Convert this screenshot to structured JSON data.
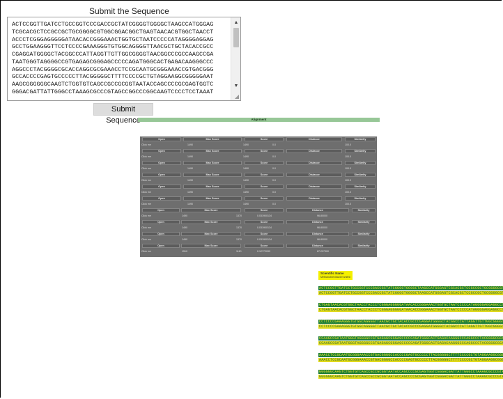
{
  "form": {
    "title": "Submit the Sequence",
    "sequence": "ACTCCGGTTGATCCTGCCGGTCCCGACCGCTATCGGGGTGGGGCTAAGCCATGGGAG\nTCGCACGCTCCGCCGCTGCGGGGCGTGGCGGACGGCTGAGTAACACGTGGCTAACCT\nACCCTCGGGAGGGGGATAACACCGGGAAACTGGTGCTAATCCCCCATAGGGGAGGAG\nGCCTGGAAGGGTTCCTCCCCGAAAGGGTGTGGCAGGGGTTAACGCTGCTACACCGCC\nCGAGGATGGGGCTACGGCCCATTAGGTTGTTGGCGGGGTAACGGCCCGCCAAGCCGA\nTAATGGGTAGGGGCCGTGAGAGCGGGAGCCCCCAGATGGGCACTGAGACAAGGGCCC\nAGGCCCTACGGGGCGCACCAGGCGCGAAACCTCCGCAATGCGGGAAACCGTGACGGG\nGCCACCCCGAGTGCCCCCTTACGGGGGCTTTTCCCCGCTGTAGGAAGGCGGGGGAAT\nAAGCGGGGGGCAAGTCTGGTGTCAGCCGCCGCGGTAATACCAGCCCCGCGAGTGGTC\nGGGACGATTATTGGGCCTAAAGCGCCCGTAGCCGGCCCGGCAAGTCCCCTCCTAAAT",
    "submit_label": "Submit Sequence"
  },
  "alignment": {
    "title": "Alignment",
    "headers": {
      "open": "Open",
      "max_score": "Max Score",
      "score": "Score",
      "distance": "Distance",
      "similarity": "Similarity"
    },
    "rows": [
      {
        "action": "Click me",
        "max_score": "1490",
        "score": "1490",
        "distance": "0.0",
        "similarity": "100.0"
      },
      {
        "action": "Click me",
        "max_score": "1490",
        "score": "1490",
        "distance": "0.0",
        "similarity": "100.0"
      },
      {
        "action": "Click me",
        "max_score": "1490",
        "score": "1490",
        "distance": "0.0",
        "similarity": "100.0"
      },
      {
        "action": "Click me",
        "max_score": "1490",
        "score": "1490",
        "distance": "0.0",
        "similarity": "100.0"
      },
      {
        "action": "Click me",
        "max_score": "1490",
        "score": "1490",
        "distance": "0.0",
        "similarity": "100.0"
      },
      {
        "action": "Click me",
        "max_score": "1490",
        "score": "1490",
        "distance": "0.0",
        "similarity": "100.0"
      },
      {
        "action": "Click me",
        "max_score": "1490",
        "score": "1370",
        "distance": "0.031900134",
        "similarity": "96.80000"
      },
      {
        "action": "Click me",
        "max_score": "1490",
        "score": "1370",
        "distance": "0.031900134",
        "similarity": "96.80000"
      },
      {
        "action": "Click me",
        "max_score": "1490",
        "score": "1370",
        "distance": "0.031900134",
        "similarity": "96.80000"
      },
      {
        "action": "Click me",
        "max_score": "1510",
        "score": "1110",
        "distance": "0.12772099",
        "similarity": "87.227900"
      }
    ]
  },
  "scientific": {
    "label": "Scientific Name",
    "value": "Methanobrevibacter smithii"
  },
  "sequence_strips": [
    {
      "top": "ACTCCGGTTGATCCTGCCGGTCCCGACCGCTATCGGGGTGGGGCTAAGCCATGGGAGTCGCACGCTCCGCCGCTGCGGGGCGTGGCGGACGG",
      "bottom": "ACTCCGGTTGATCCTGCCGGTCCCGACCGCTATCGGGGTGGGGCTAAGCCATGGGAGTCGCACGCTCCGCCGCTGCGGGGCGTGGCGGACGG"
    },
    {
      "top": "CTGAGTAACACGTGGCTAACCTACCCTCGGGAGGGGGATAACACCGGGAAACTGGTGCTAATCCCCCATAGGGGAGGAGGCCTGGAAGGGTT",
      "bottom": "CTGAGTAACACGTGGCTAACCTACCCTCGGGAGGGGGATAACACCGGGAAACTGGTGCTAATCCCCCATAGGGGAGGAGGCCTGGAAGGGTT"
    },
    {
      "top": "CCTCCCCGAAAGGGTGTGGCAGGGGTTAACGCTGCTACACCGCCCGAGGATGGGGCTACGGCCCATTAGGTTGTTGGCGGGGTAACGGCCCG",
      "bottom": "CCTCCCCGAAAGGGTGTGGCAGGGGTTAACGCTGCTACACCGCCCGAGGATGGGGCTACGGCCCATTAGGTTGTTGGCGGGGTAACGGCCCG"
    },
    {
      "top": "CCAAGCCGATAATGGGTAGGGGCCGTGAGAGCGGGAGCCCCCAGATGGGCACTGAGACAAGGGCCCAGGCCCTACGGGGCGCACCAGGCGCG",
      "bottom": "CCAAGCCGATAATGGGTAGGGGCCGTGAGAGCGGGAGCCCCCAGATGGGCACTGAGACAAGGGCCCAGGCCCTACGGGGCGCACCAGGCGCG"
    },
    {
      "top": "AAACCTCCGCAATGCGGGAAACCGTGACGGGGCCACCCCGAGTGCCCCCTTACGGGGGCTTTTCCCCGCTGTAGGAAGGCGGGGGAATAAGC",
      "bottom": "AAACCTCCGCAATGCGGGAAACCGTGACGGGGCCACCCCGAGTGCCCCCTTACGGGGGCTTTTCCCCGCTGTAGGAAGGCGGGGGAATAAGC"
    },
    {
      "top": "GGGGGGCAAGTCTGGTGTCAGCCGCCGCGGTAATACCAGCCCCGCGAGTGGTCGGGACGATTATTGGGCCTAAAGCGCCCGTAGCCGGCCCG",
      "bottom": "GGGGGGCAAGTCTGGTGTCAGCCGCCGCGGTAATACCAGCCCCGCGAGTGGTCGGGACGATTATTGGGCCTAAAGCGCCCGTAGCCGGCCCG"
    }
  ]
}
